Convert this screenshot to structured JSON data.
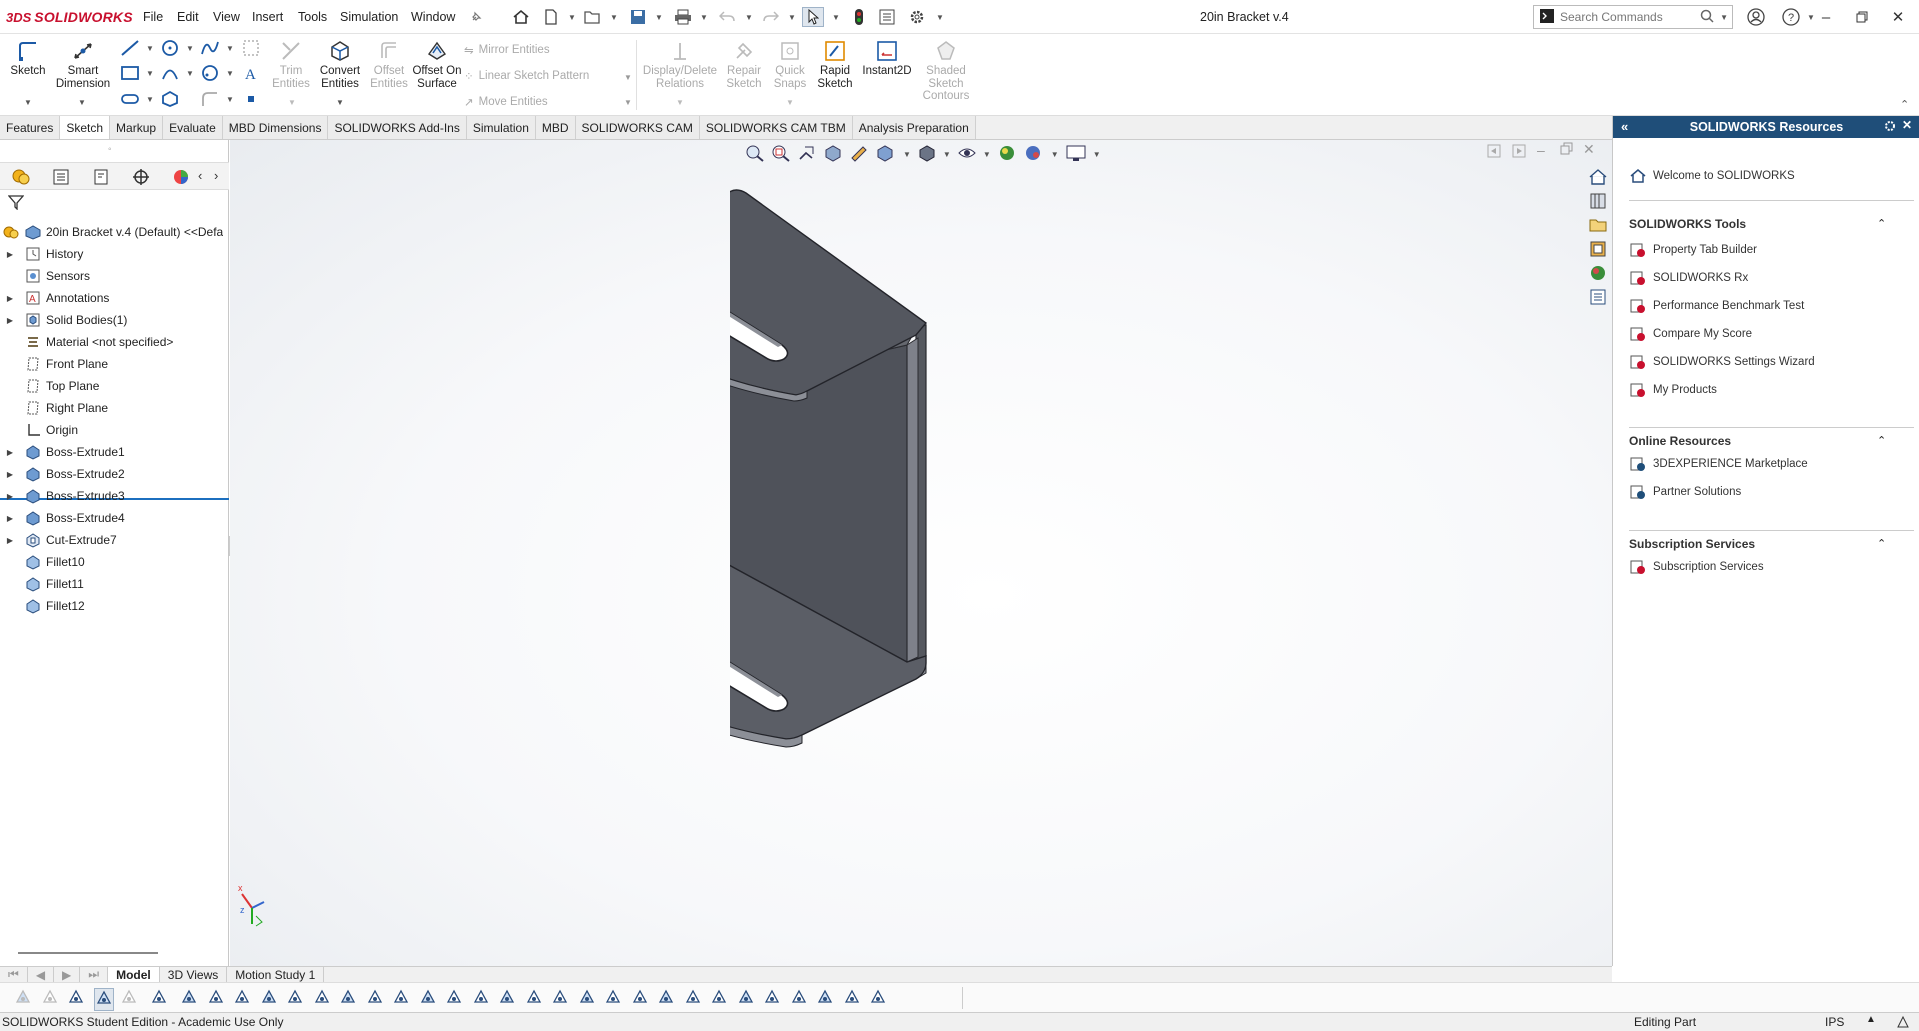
{
  "app": {
    "brand_prefix": "3DS",
    "brand": "SOLIDWORKS",
    "document_title": "20in Bracket v.4"
  },
  "menus": [
    "File",
    "Edit",
    "View",
    "Insert",
    "Tools",
    "Simulation",
    "Window"
  ],
  "search": {
    "placeholder": "Search Commands"
  },
  "sketch_tools": [
    {
      "label": "Sketch",
      "enabled": true
    },
    {
      "label": "Smart Dimension",
      "enabled": true
    },
    {
      "label": "Trim Entities",
      "enabled": false
    },
    {
      "label": "Convert Entities",
      "enabled": true
    },
    {
      "label": "Offset Entities",
      "enabled": false
    },
    {
      "label": "Offset On Surface",
      "enabled": true
    },
    {
      "label": "Display/Delete Relations",
      "enabled": false
    },
    {
      "label": "Repair Sketch",
      "enabled": false
    },
    {
      "label": "Quick Snaps",
      "enabled": false
    },
    {
      "label": "Rapid Sketch",
      "enabled": true
    },
    {
      "label": "Instant2D",
      "enabled": true
    },
    {
      "label": "Shaded Sketch Contours",
      "enabled": false
    }
  ],
  "small_tools": [
    "Mirror Entities",
    "Linear Sketch Pattern",
    "Move Entities"
  ],
  "command_tabs": [
    "Features",
    "Sketch",
    "Markup",
    "Evaluate",
    "MBD Dimensions",
    "SOLIDWORKS Add-Ins",
    "Simulation",
    "MBD",
    "SOLIDWORKS CAM",
    "SOLIDWORKS CAM TBM",
    "Analysis Preparation"
  ],
  "active_tab": "Sketch",
  "tree": {
    "root": "20in Bracket v.4 (Default) <<Defa",
    "items": [
      {
        "label": "History",
        "expandable": true
      },
      {
        "label": "Sensors",
        "expandable": false
      },
      {
        "label": "Annotations",
        "expandable": true
      },
      {
        "label": "Solid Bodies(1)",
        "expandable": true
      },
      {
        "label": "Material <not specified>",
        "expandable": false
      },
      {
        "label": "Front Plane",
        "expandable": false
      },
      {
        "label": "Top Plane",
        "expandable": false
      },
      {
        "label": "Right Plane",
        "expandable": false
      },
      {
        "label": "Origin",
        "expandable": false
      },
      {
        "label": "Boss-Extrude1",
        "expandable": true
      },
      {
        "label": "Boss-Extrude2",
        "expandable": true
      },
      {
        "label": "Boss-Extrude3",
        "expandable": true
      },
      {
        "label": "Boss-Extrude4",
        "expandable": true
      },
      {
        "label": "Cut-Extrude7",
        "expandable": true
      },
      {
        "label": "Fillet10",
        "expandable": false
      },
      {
        "label": "Fillet11",
        "expandable": false
      },
      {
        "label": "Fillet12",
        "expandable": false
      }
    ]
  },
  "resources": {
    "title": "SOLIDWORKS Resources",
    "welcome": "Welcome to SOLIDWORKS",
    "tools_heading": "SOLIDWORKS Tools",
    "tools": [
      "Property Tab Builder",
      "SOLIDWORKS Rx",
      "Performance Benchmark Test",
      "Compare My Score",
      "SOLIDWORKS Settings Wizard",
      "My Products"
    ],
    "online_heading": "Online Resources",
    "online": [
      "3DEXPERIENCE Marketplace",
      "Partner Solutions"
    ],
    "subs_heading": "Subscription Services",
    "subs": [
      "Subscription Services"
    ]
  },
  "bottom_tabs": [
    "Model",
    "3D Views",
    "Motion Study 1"
  ],
  "status": {
    "left": "SOLIDWORKS Student Edition - Academic Use Only",
    "mode": "Editing Part",
    "units": "IPS"
  },
  "colors": {
    "brand": "#c8102e",
    "resource_header": "#1f4e79",
    "part": "#4a4d55"
  }
}
